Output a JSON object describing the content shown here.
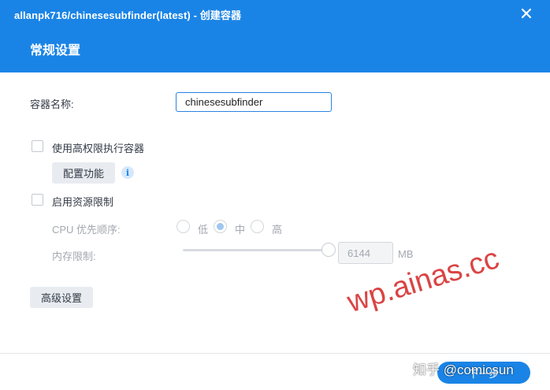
{
  "window": {
    "title": "allanpk716/chinesesubfinder(latest) - 创建容器",
    "close_icon": "close-icon"
  },
  "section": {
    "title": "常规设置"
  },
  "container_name": {
    "label": "容器名称:",
    "value": "chinesesubfinder"
  },
  "privileged": {
    "label": "使用高权限执行容器",
    "checked": false,
    "config_button": "配置功能",
    "info_icon": "info-icon"
  },
  "resource_limit": {
    "label": "启用资源限制",
    "checked": false,
    "cpu_label": "CPU 优先顺序:",
    "cpu_options": [
      "低",
      "中",
      "高"
    ],
    "cpu_selected": "中",
    "memory_label": "内存限制:",
    "memory_value": "6144",
    "memory_unit": "MB",
    "memory_slider_fraction": 1.0
  },
  "advanced_button": "高级设置",
  "footer": {
    "next_button": "下一步"
  },
  "watermark": {
    "text": "wp.ainas.cc",
    "credit": "知乎 @comicsun"
  },
  "colors": {
    "accent": "#1a84e6",
    "watermark": "#d93a3a"
  }
}
